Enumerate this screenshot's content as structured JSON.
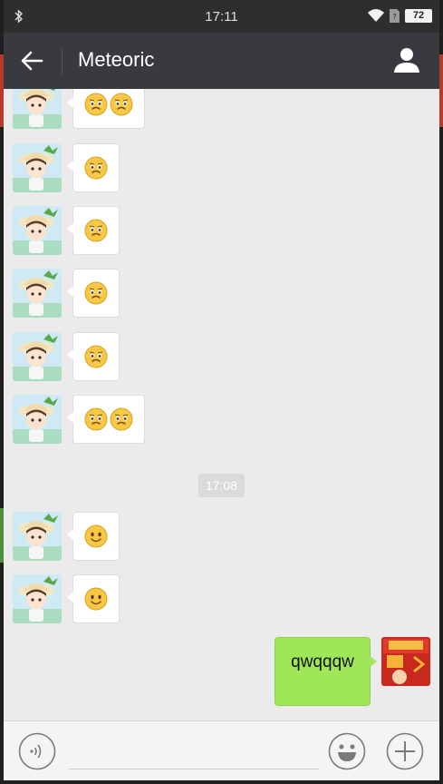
{
  "status_bar": {
    "time": "17:11",
    "battery": "72",
    "icons": [
      "bluetooth-icon",
      "wifi-icon",
      "no-sim-icon",
      "battery-icon"
    ]
  },
  "header": {
    "title": "Meteoric",
    "icons": [
      "back-arrow-icon",
      "profile-icon"
    ]
  },
  "chat": {
    "timestamp": "17:08",
    "messages": [
      {
        "from": "other",
        "emoji": [
          "frown-emoji",
          "frown-emoji"
        ]
      },
      {
        "from": "other",
        "emoji": [
          "frown-emoji"
        ]
      },
      {
        "from": "other",
        "emoji": [
          "frown-emoji"
        ]
      },
      {
        "from": "other",
        "emoji": [
          "frown-emoji"
        ]
      },
      {
        "from": "other",
        "emoji": [
          "frown-emoji"
        ]
      },
      {
        "from": "other",
        "emoji": [
          "frown-emoji",
          "frown-emoji"
        ]
      },
      {
        "from": "other",
        "emoji": [
          "smile-emoji"
        ]
      },
      {
        "from": "other",
        "emoji": [
          "smile-emoji"
        ]
      },
      {
        "from": "me",
        "text": "qwqqqw"
      }
    ]
  },
  "input_bar": {
    "icons": [
      "voice-icon",
      "emoji-icon",
      "plus-icon"
    ]
  },
  "colors": {
    "header_bg": "#393a3f",
    "status_bg": "#2e2e2e",
    "chat_bg": "#ebebeb",
    "outgoing_bubble": "#9fe658",
    "incoming_bubble": "#ffffff"
  }
}
